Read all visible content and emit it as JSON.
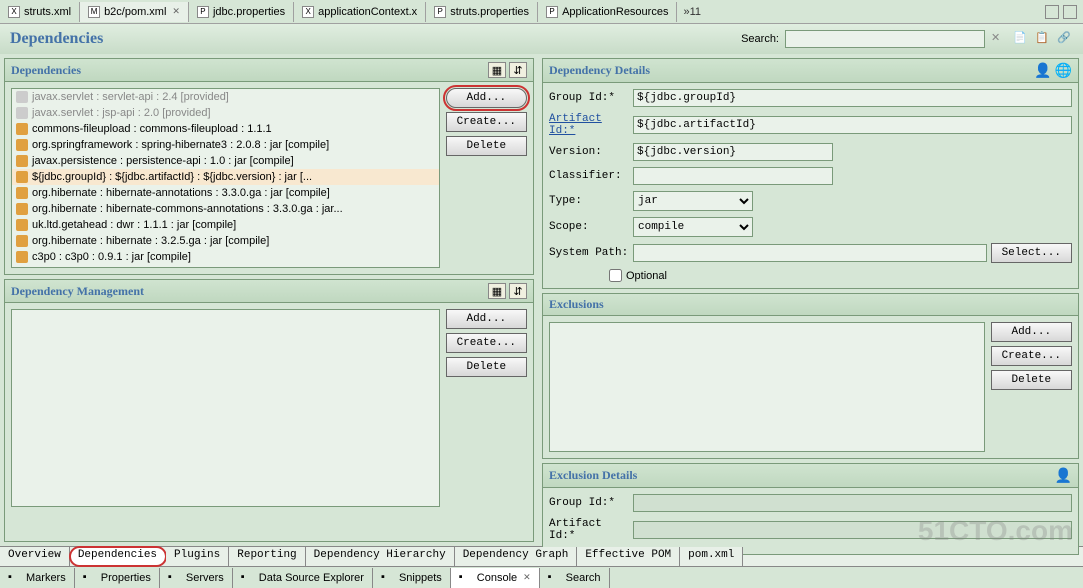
{
  "editor_tabs": [
    {
      "icon": "X",
      "label": "struts.xml"
    },
    {
      "icon": "M",
      "label": "b2c/pom.xml",
      "active": true,
      "closable": true
    },
    {
      "icon": "P",
      "label": "jdbc.properties"
    },
    {
      "icon": "X",
      "label": "applicationContext.x"
    },
    {
      "icon": "P",
      "label": "struts.properties"
    },
    {
      "icon": "P",
      "label": "ApplicationResources"
    }
  ],
  "tab_more": "»11",
  "page_title": "Dependencies",
  "search_label": "Search:",
  "sections": {
    "dependencies": {
      "title": "Dependencies",
      "items": [
        {
          "text": "javax.servlet : servlet-api : 2.4 [provided]",
          "disabled": true
        },
        {
          "text": "javax.servlet : jsp-api : 2.0 [provided]",
          "disabled": true
        },
        {
          "text": "commons-fileupload : commons-fileupload : 1.1.1"
        },
        {
          "text": "org.springframework : spring-hibernate3 : 2.0.8 : jar [compile]"
        },
        {
          "text": "javax.persistence : persistence-api : 1.0 : jar [compile]"
        },
        {
          "text": "${jdbc.groupId} : ${jdbc.artifactId} : ${jdbc.version} : jar [...",
          "selected": true
        },
        {
          "text": "org.hibernate : hibernate-annotations : 3.3.0.ga : jar [compile]"
        },
        {
          "text": "org.hibernate : hibernate-commons-annotations : 3.3.0.ga : jar..."
        },
        {
          "text": "uk.ltd.getahead : dwr : 1.1.1 : jar [compile]"
        },
        {
          "text": "org.hibernate : hibernate : 3.2.5.ga : jar [compile]"
        },
        {
          "text": "c3p0 : c3p0 : 0.9.1 : jar [compile]"
        }
      ],
      "buttons": {
        "add": "Add...",
        "create": "Create...",
        "delete": "Delete"
      }
    },
    "dep_mgmt": {
      "title": "Dependency Management",
      "buttons": {
        "add": "Add...",
        "create": "Create...",
        "delete": "Delete"
      }
    },
    "details": {
      "title": "Dependency Details",
      "group_id_label": "Group Id:*",
      "group_id": "${jdbc.groupId}",
      "artifact_id_label": "Artifact Id:*",
      "artifact_id": "${jdbc.artifactId}",
      "version_label": "Version:",
      "version": "${jdbc.version}",
      "classifier_label": "Classifier:",
      "classifier": "",
      "type_label": "Type:",
      "type": "jar",
      "scope_label": "Scope:",
      "scope": "compile",
      "system_path_label": "System Path:",
      "system_path": "",
      "select_btn": "Select...",
      "optional_label": "Optional"
    },
    "exclusions": {
      "title": "Exclusions",
      "buttons": {
        "add": "Add...",
        "create": "Create...",
        "delete": "Delete"
      }
    },
    "excl_details": {
      "title": "Exclusion Details",
      "group_id_label": "Group Id:*",
      "artifact_id_label": "Artifact Id:*"
    }
  },
  "pom_tabs": [
    "Overview",
    "Dependencies",
    "Plugins",
    "Reporting",
    "Dependency Hierarchy",
    "Dependency Graph",
    "Effective POM",
    "pom.xml"
  ],
  "pom_tab_active": 1,
  "view_tabs": [
    {
      "label": "Markers"
    },
    {
      "label": "Properties"
    },
    {
      "label": "Servers"
    },
    {
      "label": "Data Source Explorer"
    },
    {
      "label": "Snippets"
    },
    {
      "label": "Console",
      "active": true,
      "closable": true
    },
    {
      "label": "Search"
    }
  ],
  "watermark": "51CTO.com"
}
